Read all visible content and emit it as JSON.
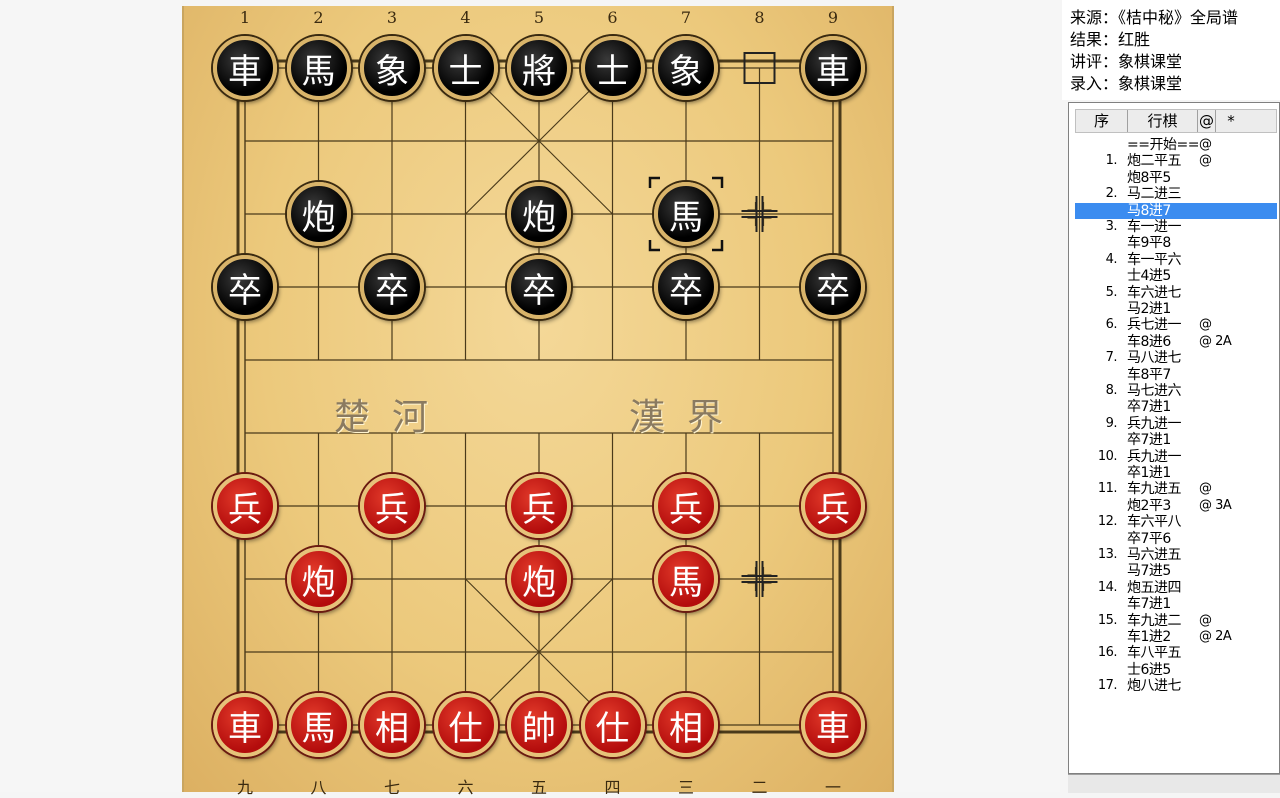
{
  "board": {
    "file_numbers_top": [
      "1",
      "2",
      "3",
      "4",
      "5",
      "6",
      "7",
      "8",
      "9"
    ],
    "file_numbers_bottom": [
      "九",
      "八",
      "七",
      "六",
      "五",
      "四",
      "三",
      "二",
      "一"
    ],
    "river_left": "楚河",
    "river_right": "漢界"
  },
  "pieces": [
    {
      "side": "black",
      "char": "車",
      "file": 0,
      "rank": 0
    },
    {
      "side": "black",
      "char": "馬",
      "file": 1,
      "rank": 0
    },
    {
      "side": "black",
      "char": "象",
      "file": 2,
      "rank": 0
    },
    {
      "side": "black",
      "char": "士",
      "file": 3,
      "rank": 0
    },
    {
      "side": "black",
      "char": "將",
      "file": 4,
      "rank": 0
    },
    {
      "side": "black",
      "char": "士",
      "file": 5,
      "rank": 0
    },
    {
      "side": "black",
      "char": "象",
      "file": 6,
      "rank": 0
    },
    {
      "side": "black",
      "char": "車",
      "file": 8,
      "rank": 0
    },
    {
      "side": "black",
      "char": "炮",
      "file": 1,
      "rank": 2
    },
    {
      "side": "black",
      "char": "炮",
      "file": 4,
      "rank": 2
    },
    {
      "side": "black",
      "char": "馬",
      "file": 6,
      "rank": 2,
      "selected": true
    },
    {
      "side": "black",
      "char": "卒",
      "file": 0,
      "rank": 3
    },
    {
      "side": "black",
      "char": "卒",
      "file": 2,
      "rank": 3
    },
    {
      "side": "black",
      "char": "卒",
      "file": 4,
      "rank": 3
    },
    {
      "side": "black",
      "char": "卒",
      "file": 6,
      "rank": 3
    },
    {
      "side": "black",
      "char": "卒",
      "file": 8,
      "rank": 3
    },
    {
      "side": "red",
      "char": "兵",
      "file": 0,
      "rank": 6
    },
    {
      "side": "red",
      "char": "兵",
      "file": 2,
      "rank": 6
    },
    {
      "side": "red",
      "char": "兵",
      "file": 4,
      "rank": 6
    },
    {
      "side": "red",
      "char": "兵",
      "file": 6,
      "rank": 6
    },
    {
      "side": "red",
      "char": "兵",
      "file": 8,
      "rank": 6
    },
    {
      "side": "red",
      "char": "炮",
      "file": 1,
      "rank": 7
    },
    {
      "side": "red",
      "char": "炮",
      "file": 4,
      "rank": 7
    },
    {
      "side": "red",
      "char": "馬",
      "file": 6,
      "rank": 7
    },
    {
      "side": "red",
      "char": "車",
      "file": 0,
      "rank": 9
    },
    {
      "side": "red",
      "char": "馬",
      "file": 1,
      "rank": 9
    },
    {
      "side": "red",
      "char": "相",
      "file": 2,
      "rank": 9
    },
    {
      "side": "red",
      "char": "仕",
      "file": 3,
      "rank": 9
    },
    {
      "side": "red",
      "char": "帥",
      "file": 4,
      "rank": 9
    },
    {
      "side": "red",
      "char": "仕",
      "file": 5,
      "rank": 9
    },
    {
      "side": "red",
      "char": "相",
      "file": 6,
      "rank": 9
    },
    {
      "side": "red",
      "char": "車",
      "file": 8,
      "rank": 9
    }
  ],
  "last_move_from": {
    "file": 7,
    "rank": 0
  },
  "cross_marks": [
    {
      "file": 7,
      "rank": 2
    },
    {
      "file": 7,
      "rank": 7
    }
  ],
  "info": {
    "source": "来源：《桔中秘》全局谱",
    "result": "结果：红胜",
    "commentary": "讲评：象棋课堂",
    "entry": "录入：象棋课堂"
  },
  "movelist": {
    "headers": [
      "序",
      "行棋",
      "@",
      "*"
    ],
    "rows": [
      {
        "num": "",
        "move": "==开始==",
        "mark": "@"
      },
      {
        "num": "1.",
        "move": "炮二平五",
        "mark": "@"
      },
      {
        "num": "",
        "move": "炮8平5",
        "mark": ""
      },
      {
        "num": "2.",
        "move": "马二进三",
        "mark": ""
      },
      {
        "num": "",
        "move": "马8进7",
        "mark": "",
        "highlight": true
      },
      {
        "num": "3.",
        "move": "车一进一",
        "mark": ""
      },
      {
        "num": "",
        "move": "车9平8",
        "mark": ""
      },
      {
        "num": "4.",
        "move": "车一平六",
        "mark": ""
      },
      {
        "num": "",
        "move": "士4进5",
        "mark": ""
      },
      {
        "num": "5.",
        "move": "车六进七",
        "mark": ""
      },
      {
        "num": "",
        "move": "马2进1",
        "mark": ""
      },
      {
        "num": "6.",
        "move": "兵七进一",
        "mark": "@"
      },
      {
        "num": "",
        "move": "车8进6",
        "mark": "@ 2A"
      },
      {
        "num": "7.",
        "move": "马八进七",
        "mark": ""
      },
      {
        "num": "",
        "move": "车8平7",
        "mark": ""
      },
      {
        "num": "8.",
        "move": "马七进六",
        "mark": ""
      },
      {
        "num": "",
        "move": "卒7进1",
        "mark": ""
      },
      {
        "num": "9.",
        "move": "兵九进一",
        "mark": ""
      },
      {
        "num": "",
        "move": "卒7进1",
        "mark": ""
      },
      {
        "num": "10.",
        "move": "兵九进一",
        "mark": ""
      },
      {
        "num": "",
        "move": "卒1进1",
        "mark": ""
      },
      {
        "num": "11.",
        "move": "车九进五",
        "mark": "@"
      },
      {
        "num": "",
        "move": "炮2平3",
        "mark": "@ 3A"
      },
      {
        "num": "12.",
        "move": "车六平八",
        "mark": ""
      },
      {
        "num": "",
        "move": "卒7平6",
        "mark": ""
      },
      {
        "num": "13.",
        "move": "马六进五",
        "mark": ""
      },
      {
        "num": "",
        "move": "马7进5",
        "mark": ""
      },
      {
        "num": "14.",
        "move": "炮五进四",
        "mark": ""
      },
      {
        "num": "",
        "move": "车7进1",
        "mark": ""
      },
      {
        "num": "15.",
        "move": "车九进二",
        "mark": "@"
      },
      {
        "num": "",
        "move": "车1进2",
        "mark": "@ 2A"
      },
      {
        "num": "16.",
        "move": "车八平五",
        "mark": ""
      },
      {
        "num": "",
        "move": "士6进5",
        "mark": ""
      },
      {
        "num": "17.",
        "move": "炮八进七",
        "mark": ""
      }
    ]
  }
}
